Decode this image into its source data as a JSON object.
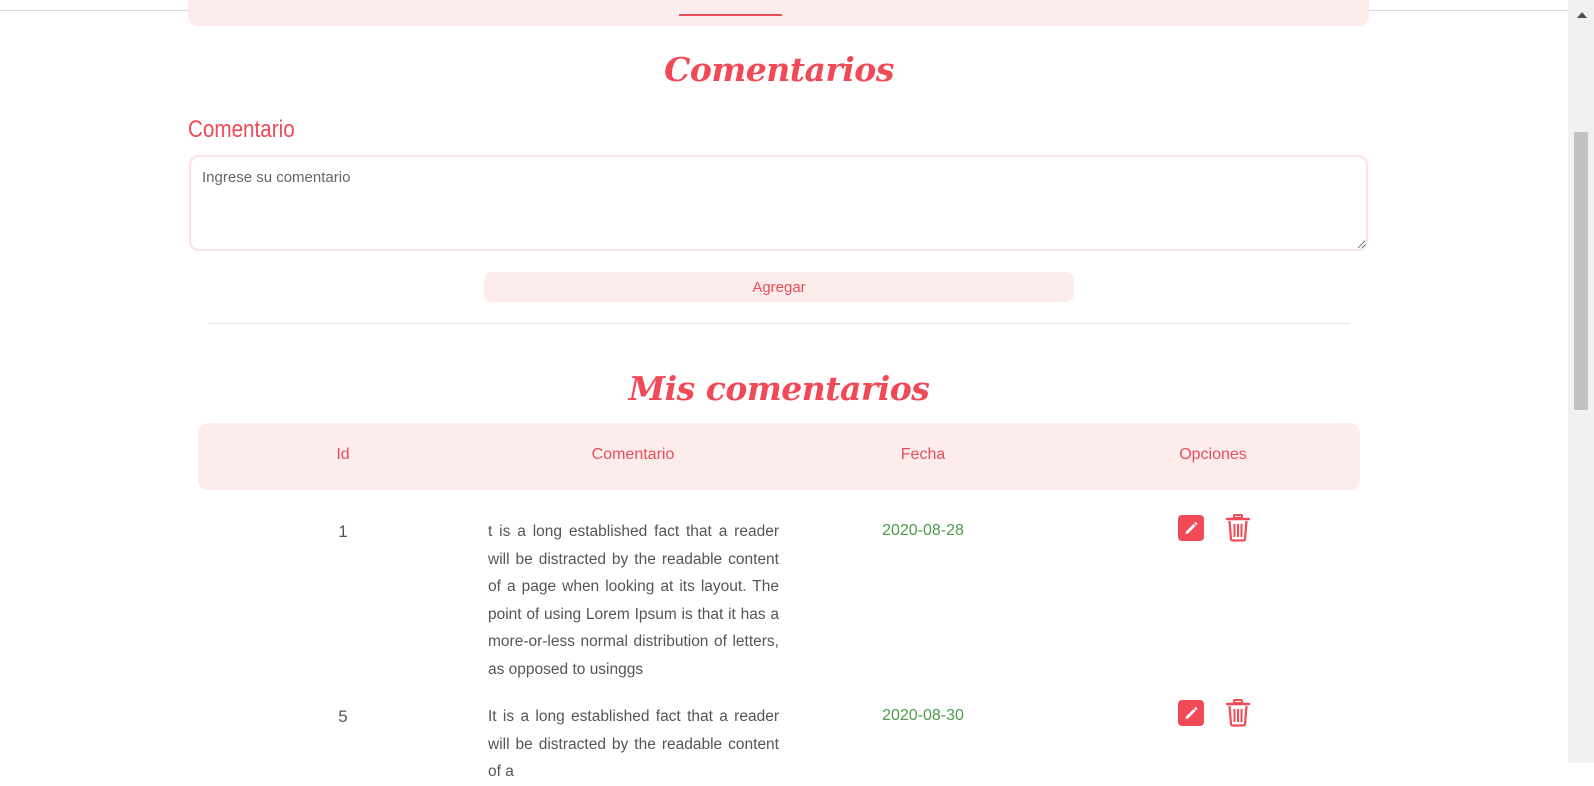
{
  "nav": {},
  "form": {
    "title": "Comentarios",
    "field_label": "Comentario",
    "textarea_placeholder": "Ingrese su comentario",
    "add_button_label": "Agregar"
  },
  "list": {
    "title": "Mis comentarios",
    "columns": [
      "Id",
      "Comentario",
      "Fecha",
      "Opciones"
    ],
    "rows": [
      {
        "id": "1",
        "comment": "t is a long established fact that a reader will be distracted by the readable content of a page when looking at its layout. The point of using Lorem Ipsum is that it has a more-or-less normal distribution of letters, as opposed to usinggs",
        "date": "2020-08-28",
        "actions": [
          "pencil-icon",
          "trash-icon"
        ]
      },
      {
        "id": "5",
        "comment": "It is a long established fact that a reader will be distracted by the readable content of a",
        "date": "2020-08-30",
        "actions": [
          "pencil-icon",
          "trash-icon"
        ]
      }
    ]
  },
  "colors": {
    "accent": "#f04a57",
    "accent_light": "#fdecec",
    "date_green": "#4f9a4a",
    "text": "#555555"
  }
}
